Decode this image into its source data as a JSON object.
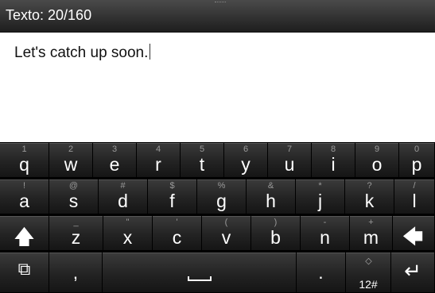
{
  "header": {
    "title": "Texto: 20/160"
  },
  "editor": {
    "text": "Let's catch up soon."
  },
  "keyboard": {
    "row1": [
      {
        "p": "q",
        "s": "1"
      },
      {
        "p": "w",
        "s": "2"
      },
      {
        "p": "e",
        "s": "3"
      },
      {
        "p": "r",
        "s": "4"
      },
      {
        "p": "t",
        "s": "5"
      },
      {
        "p": "y",
        "s": "6"
      },
      {
        "p": "u",
        "s": "7"
      },
      {
        "p": "i",
        "s": "8"
      },
      {
        "p": "o",
        "s": "9"
      },
      {
        "p": "p",
        "s": "0"
      }
    ],
    "row2": [
      {
        "p": "a",
        "s": "!"
      },
      {
        "p": "s",
        "s": "@"
      },
      {
        "p": "d",
        "s": "#"
      },
      {
        "p": "f",
        "s": "$"
      },
      {
        "p": "g",
        "s": "%"
      },
      {
        "p": "h",
        "s": "&"
      },
      {
        "p": "j",
        "s": "*"
      },
      {
        "p": "k",
        "s": "?"
      },
      {
        "p": "l",
        "s": "/"
      }
    ],
    "row3": [
      {
        "p": "z",
        "s": "_"
      },
      {
        "p": "x",
        "s": "\""
      },
      {
        "p": "c",
        "s": "'"
      },
      {
        "p": "v",
        "s": "("
      },
      {
        "p": "b",
        "s": ")"
      },
      {
        "p": "n",
        "s": "-"
      },
      {
        "p": "m",
        "s": "+"
      }
    ],
    "shift_icon": "up-arrow-icon",
    "backspace_icon": "left-arrow-icon",
    "enter_icon": "enter-arrow-icon",
    "rotate_icon": "rotate-screen-icon",
    "comma_label": ",",
    "period_label": ".",
    "symbols_label": "12#"
  }
}
